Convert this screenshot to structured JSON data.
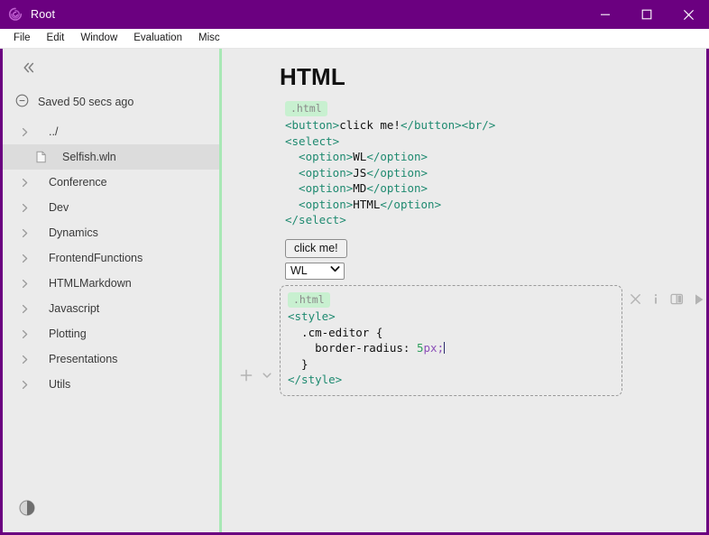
{
  "window": {
    "title": "Root",
    "logo_icon": "spiral-logo-icon",
    "titlebar_color": "#6b0080",
    "controls": {
      "minimize": "minimize-icon",
      "maximize": "maximize-icon",
      "close": "close-icon"
    }
  },
  "menubar": {
    "items": [
      {
        "label": "File"
      },
      {
        "label": "Edit"
      },
      {
        "label": "Window"
      },
      {
        "label": "Evaluation"
      },
      {
        "label": "Misc"
      }
    ]
  },
  "sidebar": {
    "collapse_icon": "chevrons-left-icon",
    "status": {
      "icon": "circle-minus-icon",
      "text": "Saved 50 secs ago"
    },
    "tree": [
      {
        "label": "../",
        "type": "folder",
        "selected": false
      },
      {
        "label": "Selfish.wln",
        "type": "file",
        "selected": true
      },
      {
        "label": "Conference",
        "type": "folder",
        "selected": false
      },
      {
        "label": "Dev",
        "type": "folder",
        "selected": false
      },
      {
        "label": "Dynamics",
        "type": "folder",
        "selected": false
      },
      {
        "label": "FrontendFunctions",
        "type": "folder",
        "selected": false
      },
      {
        "label": "HTMLMarkdown",
        "type": "folder",
        "selected": false
      },
      {
        "label": "Javascript",
        "type": "folder",
        "selected": false
      },
      {
        "label": "Plotting",
        "type": "folder",
        "selected": false
      },
      {
        "label": "Presentations",
        "type": "folder",
        "selected": false
      },
      {
        "label": "Utils",
        "type": "folder",
        "selected": false
      }
    ],
    "theme_toggle_icon": "half-circle-theme-icon",
    "divider_color": "#a8e8b5",
    "selected_row_color": "#dcdcdc"
  },
  "content": {
    "title": "HTML",
    "cell1": {
      "tag": ".html",
      "lines": [
        [
          {
            "t": "<button>",
            "c": "tag"
          },
          {
            "t": "click me!",
            "c": "plain"
          },
          {
            "t": "</button><br/>",
            "c": "tag"
          }
        ],
        [
          {
            "t": "<select>",
            "c": "tag"
          }
        ],
        [
          {
            "t": "  <option>",
            "c": "tag"
          },
          {
            "t": "WL",
            "c": "plain"
          },
          {
            "t": "</option>",
            "c": "tag"
          }
        ],
        [
          {
            "t": "  <option>",
            "c": "tag"
          },
          {
            "t": "JS",
            "c": "plain"
          },
          {
            "t": "</option>",
            "c": "tag"
          }
        ],
        [
          {
            "t": "  <option>",
            "c": "tag"
          },
          {
            "t": "MD",
            "c": "plain"
          },
          {
            "t": "</option>",
            "c": "tag"
          }
        ],
        [
          {
            "t": "  <option>",
            "c": "tag"
          },
          {
            "t": "HTML",
            "c": "plain"
          },
          {
            "t": "</option>",
            "c": "tag"
          }
        ],
        [
          {
            "t": "</select>",
            "c": "tag"
          }
        ]
      ]
    },
    "output": {
      "button_label": "click me!",
      "select_value": "WL",
      "select_options": [
        "WL",
        "JS",
        "MD",
        "HTML"
      ],
      "select_caret_icon": "chevron-down-icon"
    },
    "cell2": {
      "tag": ".html",
      "lines": [
        [
          {
            "t": "<style>",
            "c": "tag"
          }
        ],
        [
          {
            "t": "  .cm-editor {",
            "c": "plain"
          }
        ],
        [
          {
            "t": "    border-radius: ",
            "c": "plain"
          },
          {
            "t": "5",
            "c": "num"
          },
          {
            "t": "px;",
            "c": "unit"
          },
          {
            "t": "",
            "c": "caret"
          }
        ],
        [
          {
            "t": "  }",
            "c": "plain"
          }
        ],
        [
          {
            "t": "</style>",
            "c": "tag"
          }
        ]
      ],
      "left_controls": [
        {
          "name": "add-cell-button",
          "icon": "plus-icon"
        },
        {
          "name": "move-cell-down-button",
          "icon": "chevron-down-icon"
        }
      ],
      "right_controls": [
        {
          "name": "close-cell-button",
          "icon": "close-icon"
        },
        {
          "name": "cell-info-button",
          "icon": "info-icon"
        },
        {
          "name": "split-view-button",
          "icon": "split-panel-icon"
        },
        {
          "name": "run-cell-button",
          "icon": "play-icon"
        }
      ]
    }
  }
}
